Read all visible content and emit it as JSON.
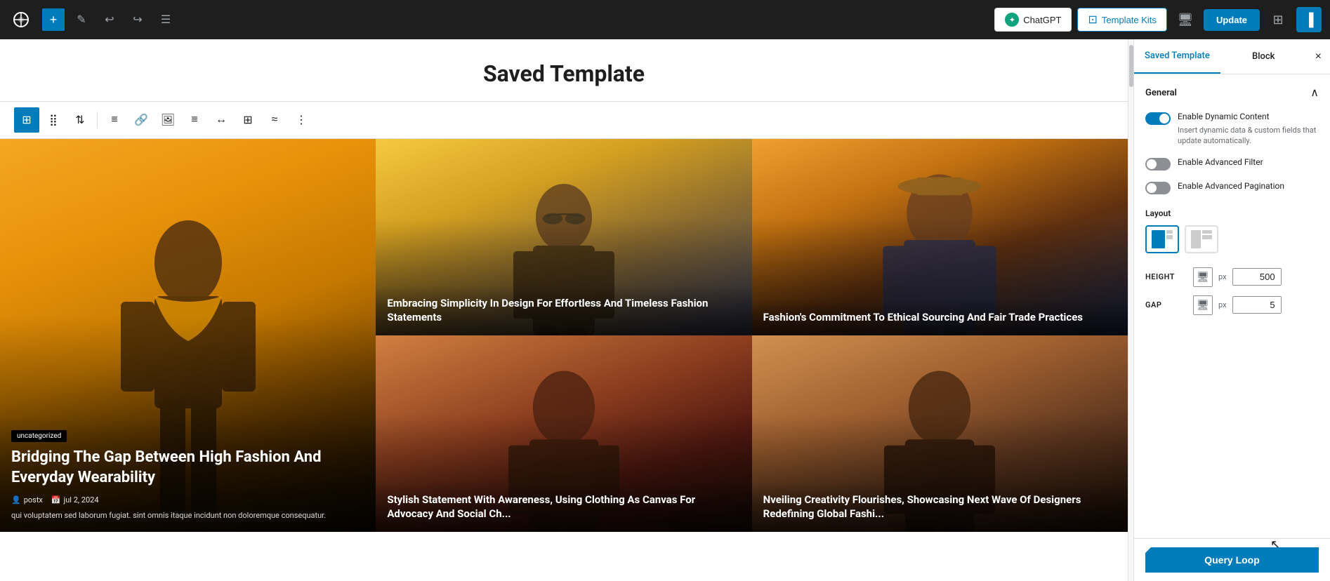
{
  "topbar": {
    "wp_logo": "W",
    "add_btn": "+",
    "edit_btn": "✎",
    "undo_btn": "↩",
    "redo_btn": "↪",
    "list_btn": "≡",
    "chatgpt_label": "ChatGPT",
    "template_kits_label": "Template Kits",
    "update_label": "Update"
  },
  "page": {
    "title": "Saved Template"
  },
  "toolbar": {
    "grid_icon": "⊞",
    "drag_icon": "⣿",
    "arrows_icon": "⇅",
    "align_center_icon": "≡",
    "link_icon": "🔗",
    "image_icon": "🖼",
    "text_align_icon": "≡",
    "resize_icon": "↔",
    "table_icon": "⊞",
    "settings_icon": "≈",
    "more_icon": "⋮"
  },
  "posts": [
    {
      "id": "post-1",
      "size": "large",
      "category": "uncategorized",
      "title": "Bridging The Gap Between High Fashion And Everyday Wearability",
      "author": "postx",
      "date": "jul 2, 2024",
      "excerpt": "qui voluptatem sed laborum fugiat. sint omnis itaque incidunt non doloremque consequatur."
    },
    {
      "id": "post-2",
      "size": "small",
      "title": "Embracing Simplicity In Design For Effortless And Timeless Fashion Statements"
    },
    {
      "id": "post-3",
      "size": "small",
      "title": "Fashion's Commitment To Ethical Sourcing And Fair Trade Practices"
    },
    {
      "id": "post-4",
      "size": "small",
      "title": "Stylish Statement With Awareness, Using Clothing As Canvas For Advocacy And Social Ch..."
    },
    {
      "id": "post-5",
      "size": "small",
      "title": "Nveiling Creativity Flourishes, Showcasing Next Wave Of Designers Redefining Global Fashi..."
    }
  ],
  "panel": {
    "tab_saved": "Saved Template",
    "tab_block": "Block",
    "close_label": "×",
    "section_general": "General",
    "toggle_dynamic_label": "Enable Dynamic Content",
    "toggle_dynamic_desc": "Insert dynamic data & custom fields that update automatically.",
    "toggle_advanced_filter_label": "Enable Advanced Filter",
    "toggle_advanced_pagination_label": "Enable Advanced Pagination",
    "layout_label": "Layout",
    "height_label": "HEIGHT",
    "height_value": "500",
    "height_unit": "px",
    "gap_label": "GAP",
    "gap_value": "5",
    "gap_unit": "px",
    "query_loop_label": "Query Loop"
  }
}
